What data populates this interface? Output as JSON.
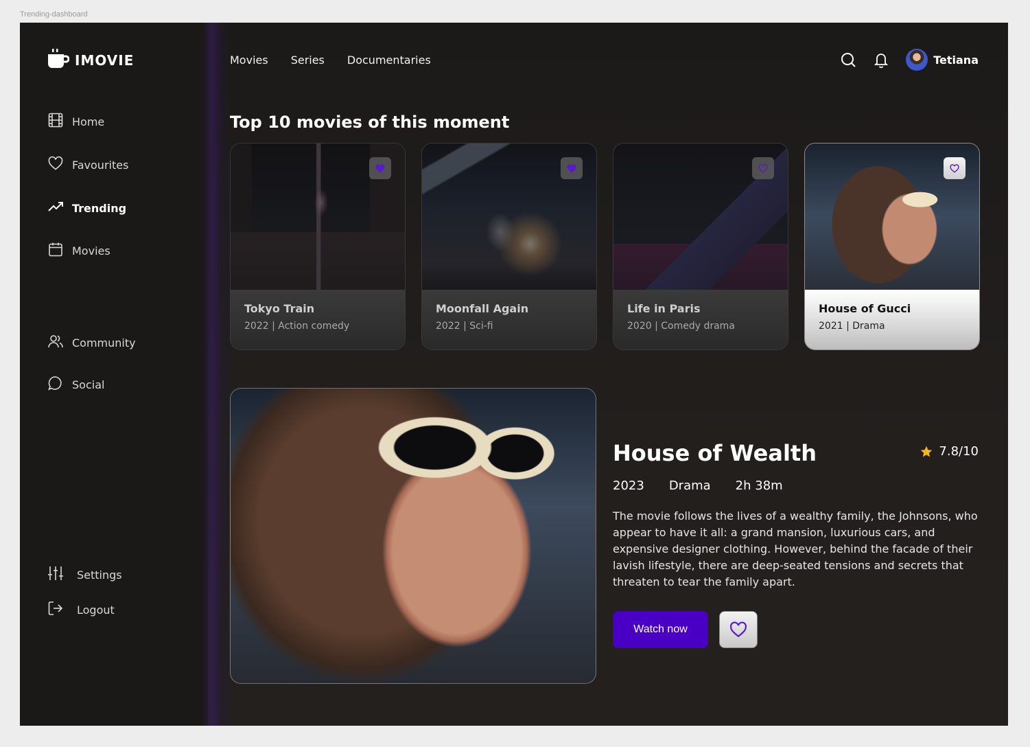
{
  "frame_label": "Trending-dashboard",
  "brand": {
    "name": "IMOVIE",
    "logo_icon": "cup-icon"
  },
  "sidebar": {
    "items": [
      {
        "label": "Home",
        "icon": "film-icon",
        "active": false
      },
      {
        "label": "Favourites",
        "icon": "heart-icon",
        "active": false
      },
      {
        "label": "Trending",
        "icon": "trending-icon",
        "active": true
      },
      {
        "label": "Movies",
        "icon": "calendar-icon",
        "active": false
      }
    ],
    "social_items": [
      {
        "label": "Community",
        "icon": "users-icon"
      },
      {
        "label": "Social",
        "icon": "chat-icon"
      }
    ],
    "bottom_items": [
      {
        "label": "Settings",
        "icon": "sliders-icon"
      },
      {
        "label": "Logout",
        "icon": "logout-icon"
      }
    ]
  },
  "topnav": {
    "items": [
      "Movies",
      "Series",
      "Documentaries"
    ]
  },
  "user": {
    "name": "Tetiana"
  },
  "section": {
    "title": "Top 10 movies of this moment"
  },
  "cards": [
    {
      "title": "Tokyo Train",
      "meta": "2022 | Action comedy",
      "selected": false
    },
    {
      "title": "Moonfall Again",
      "meta": "2022 | Sci-fi",
      "selected": false
    },
    {
      "title": "Life in Paris",
      "meta": "2020 | Comedy drama",
      "selected": false
    },
    {
      "title": "House of Gucci",
      "meta": "2021 | Drama",
      "selected": true
    }
  ],
  "featured": {
    "title": "House of Wealth",
    "rating": "7.8/10",
    "year": "2023",
    "genre": "Drama",
    "duration": "2h 38m",
    "description": "The movie follows the lives of a wealthy family, the Johnsons, who appear to have it all: a grand mansion, luxurious cars, and expensive designer clothing. However, behind the facade of their lavish lifestyle, there are deep-seated tensions and secrets that threaten to tear the family apart.",
    "watch_label": "Watch now"
  },
  "colors": {
    "accent": "#4a00c4",
    "star": "#f5b623",
    "heart": "#5b19c9"
  }
}
